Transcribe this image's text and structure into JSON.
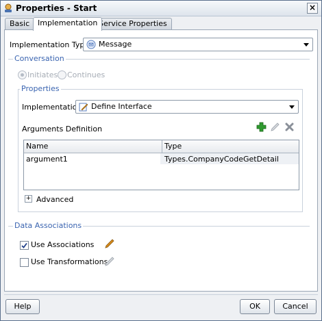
{
  "window": {
    "title": "Properties - Start"
  },
  "tabs": [
    {
      "label": "Basic",
      "active": false
    },
    {
      "label": "Implementation",
      "active": true
    },
    {
      "label": "Service Properties",
      "active": false
    }
  ],
  "implementation_type": {
    "label": "Implementation Type:",
    "value": "Message"
  },
  "conversation": {
    "title": "Conversation",
    "initiates_label": "Initiates",
    "continues_label": "Continues",
    "selected": "Initiates"
  },
  "properties": {
    "title": "Properties",
    "implementation_label": "Implementation:",
    "implementation_value": "Define Interface",
    "arguments_label": "Arguments Definition",
    "table": {
      "columns": [
        "Name",
        "Type"
      ],
      "rows": [
        [
          "argument1",
          "Types.CompanyCodeGetDetail"
        ]
      ]
    },
    "advanced_label": "Advanced",
    "expander_symbol": "+"
  },
  "data_associations": {
    "title": "Data Associations",
    "use_associations_label": "Use Associations",
    "use_associations_checked": true,
    "use_transformations_label": "Use Transformations",
    "use_transformations_checked": false
  },
  "footer": {
    "help_label": "Help",
    "ok_label": "OK",
    "cancel_label": "Cancel"
  },
  "colors": {
    "group_title": "#3a64b0",
    "add_icon": "#2f9a2f",
    "pencil_active": "#d98b1c"
  }
}
